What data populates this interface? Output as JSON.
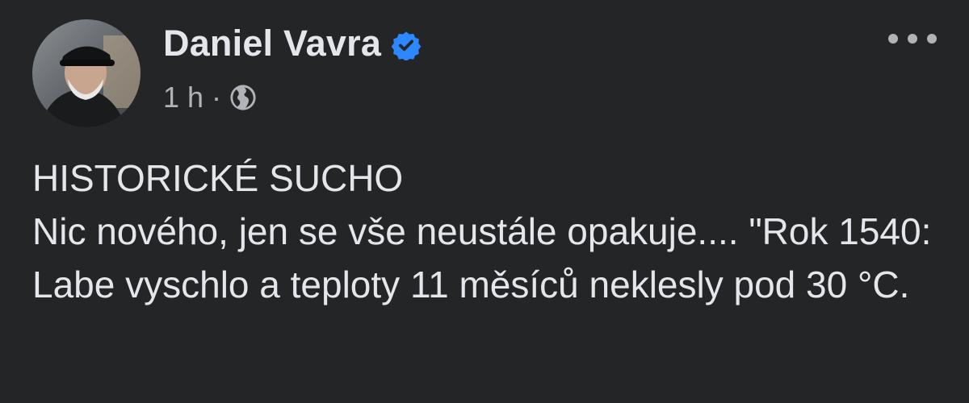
{
  "post": {
    "author": {
      "name": "Daniel Vavra",
      "avatar_icon": "profile-photo",
      "verified_icon": "verified-badge-icon",
      "verified_color": "#2d88ff"
    },
    "meta": {
      "time": "1 h",
      "separator": "·",
      "privacy_icon": "globe-icon"
    },
    "more_icon": "more-options-icon",
    "body": {
      "title": "HISTORICKÉ SUCHO",
      "text": "Nic nového, jen se vše neustále opakuje.... \"Rok 1540: Labe vyschlo a teploty 11 měsíců neklesly pod 30 °C."
    }
  },
  "colors": {
    "background": "#242526",
    "primary_text": "#e4e6eb",
    "secondary_text": "#b0b3b8"
  }
}
